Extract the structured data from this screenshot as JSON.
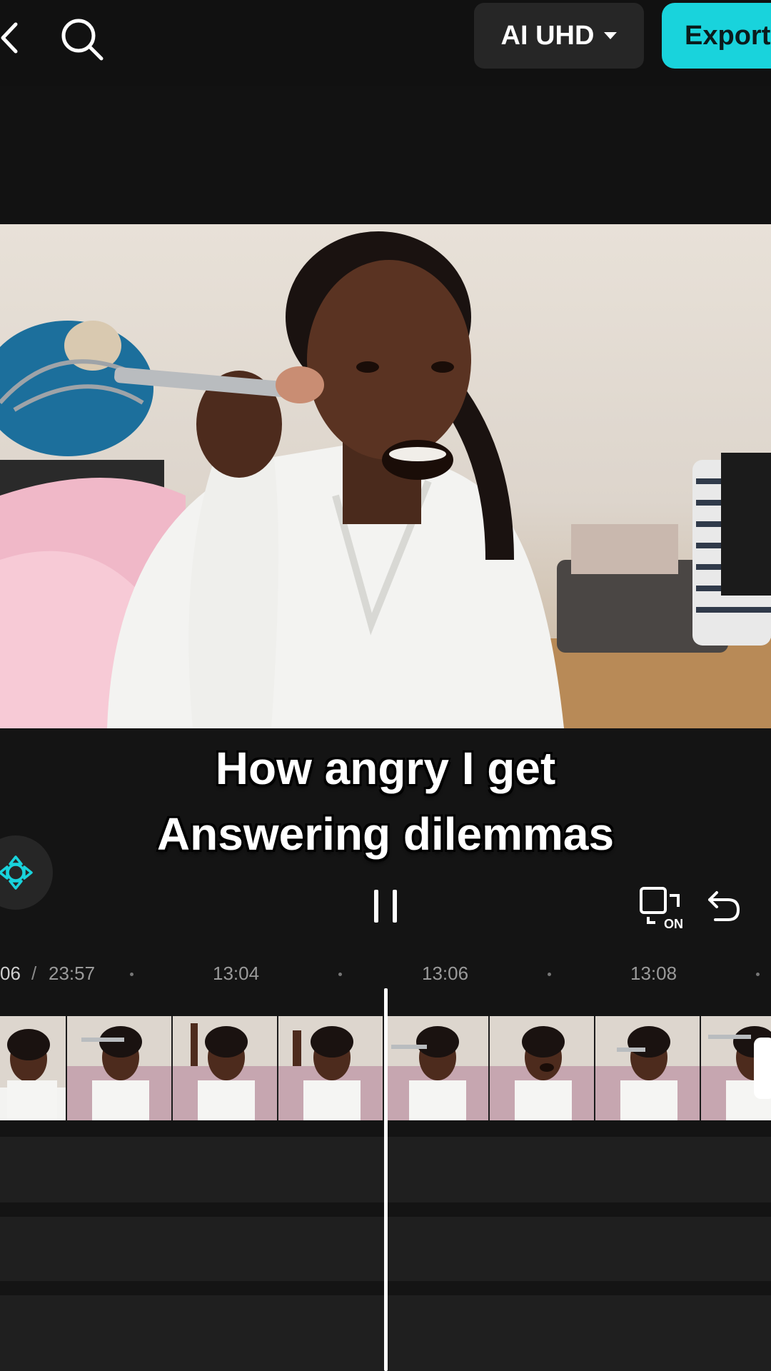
{
  "topbar": {
    "back_icon": "chevron-left-icon",
    "search_icon": "search-icon",
    "quality_label": "AI UHD",
    "export_label": "Export"
  },
  "caption": {
    "line1": "How angry I get",
    "line2": "Answering dilemmas"
  },
  "controls": {
    "play_state_icon": "pause-icon",
    "compare_icon": "compare-on-icon",
    "compare_badge": "ON",
    "undo_icon": "undo-icon",
    "keyframe_icon": "keyframe-icon"
  },
  "timeline": {
    "current_time": "06",
    "separator": "/",
    "total_time": "23:57",
    "ticks": [
      "13:04",
      "13:06",
      "13:08"
    ]
  },
  "colors": {
    "accent": "#19d3dc",
    "background": "#141414",
    "button_dark": "#262626"
  }
}
